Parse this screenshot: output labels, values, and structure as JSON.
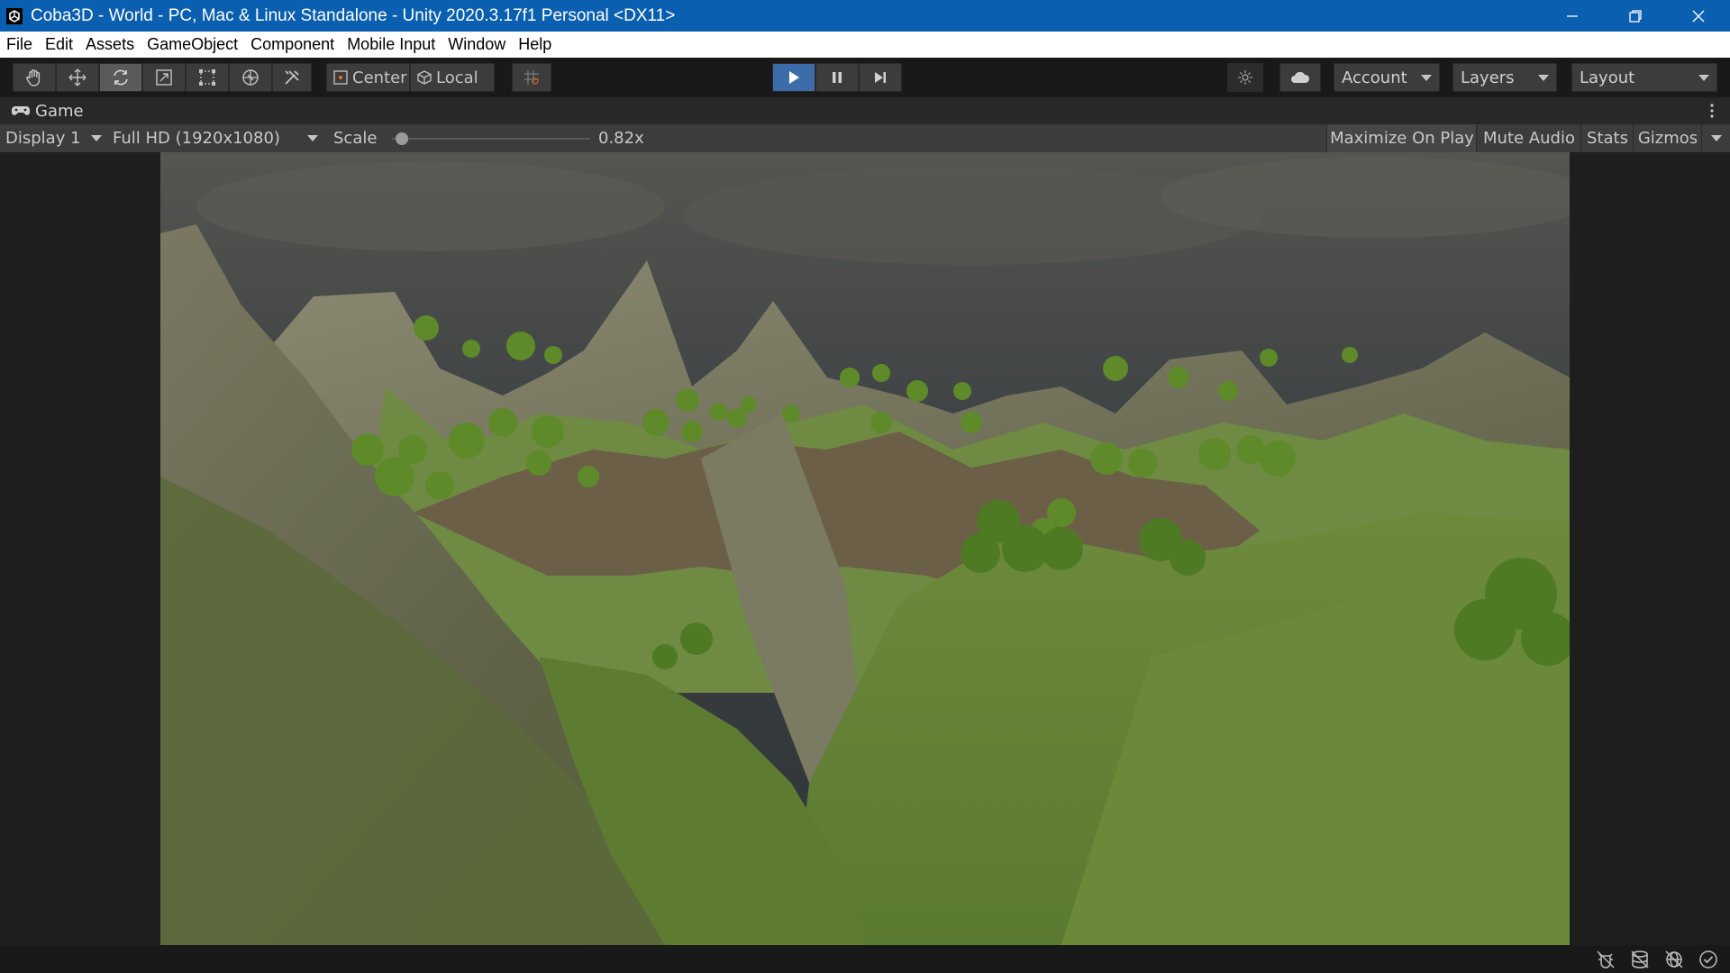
{
  "window": {
    "title": "Coba3D - World - PC, Mac & Linux Standalone - Unity 2020.3.17f1 Personal <DX11>",
    "controls": [
      "minimize-icon",
      "restore-icon",
      "close-icon"
    ]
  },
  "menu": {
    "items": [
      "File",
      "Edit",
      "Assets",
      "GameObject",
      "Component",
      "Mobile Input",
      "Window",
      "Help"
    ]
  },
  "toolbar": {
    "tools": [
      {
        "name": "hand-tool",
        "icon": "hand-icon"
      },
      {
        "name": "move-tool",
        "icon": "move-icon"
      },
      {
        "name": "rotate-tool",
        "icon": "rotate-icon",
        "active": true
      },
      {
        "name": "scale-tool",
        "icon": "scale-icon"
      },
      {
        "name": "rect-tool",
        "icon": "rect-icon"
      },
      {
        "name": "transform-tool",
        "icon": "transform-icon"
      },
      {
        "name": "custom-tool",
        "icon": "tools-icon"
      }
    ],
    "pivot_label": "Center",
    "space_label": "Local",
    "grid_snap_icon": "grid-snap-icon",
    "playback": {
      "play_active": true,
      "icons": [
        "play-icon",
        "pause-icon",
        "step-icon"
      ]
    },
    "account_label": "Account",
    "layers_label": "Layers",
    "layout_label": "Layout"
  },
  "game_tab": {
    "label": "Game",
    "icon": "gamepad-icon"
  },
  "game_toolbar": {
    "display": "Display 1",
    "resolution": "Full HD (1920x1080)",
    "scale_label": "Scale",
    "scale_value": "0.82x",
    "scale_fraction": 0.02,
    "maximize_label": "Maximize On Play",
    "mute_label": "Mute Audio",
    "stats_label": "Stats",
    "gizmos_label": "Gizmos"
  },
  "status_bar": {
    "icons": [
      "debug-icon",
      "cache-server-icon",
      "network-icon",
      "status-check-icon"
    ]
  },
  "colors": {
    "titlebar": "#0a5fb0",
    "play_active": "#3d6da8",
    "editor_bg": "#1e1e1e"
  }
}
